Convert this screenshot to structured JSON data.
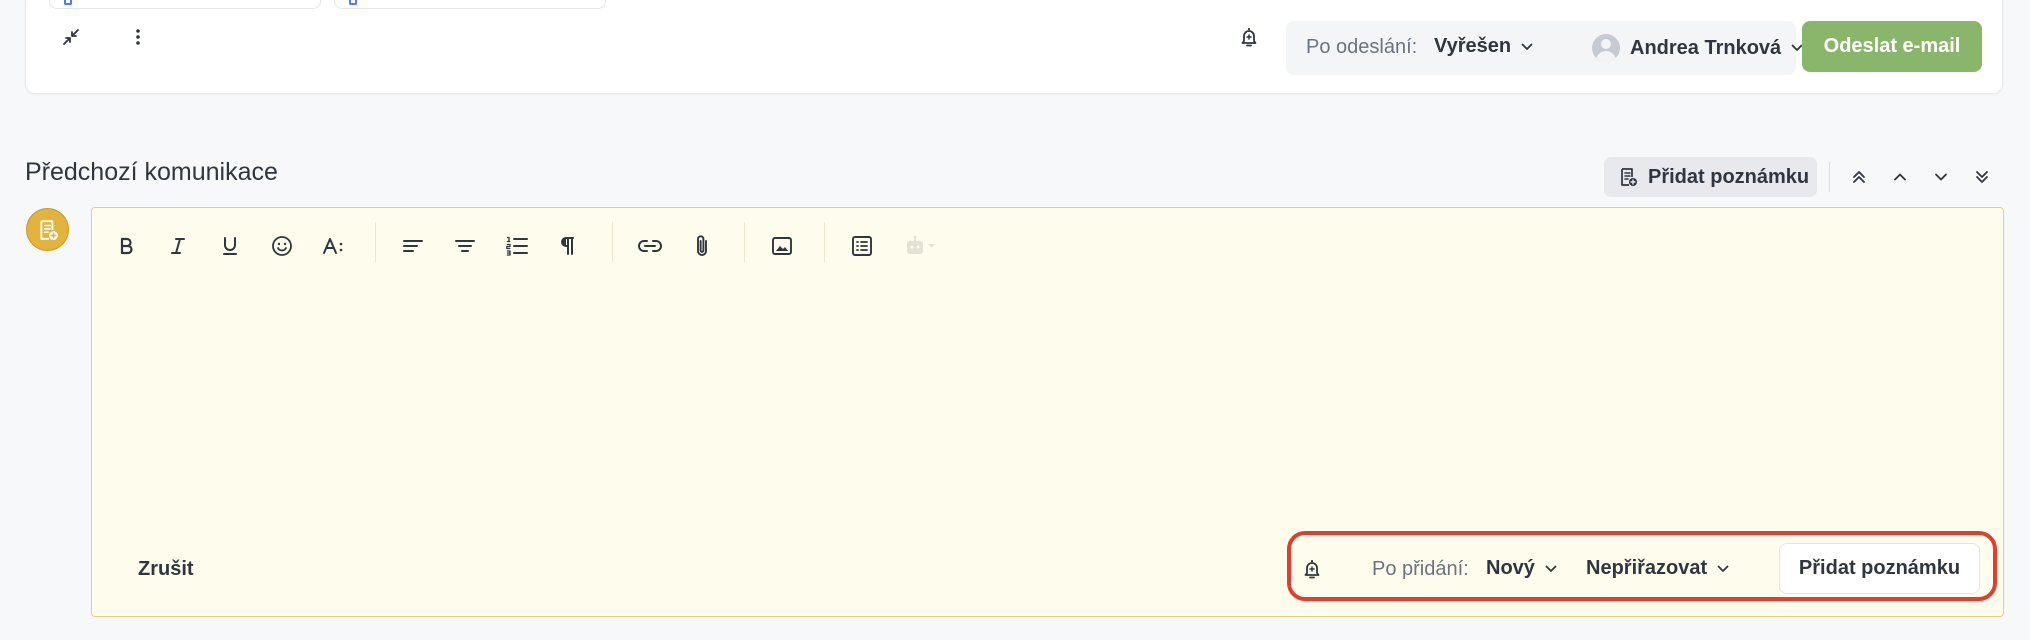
{
  "composer": {
    "after_send_label": "Po odeslání:",
    "after_send_status": "Vyřešen",
    "assignee_name": "Andrea Trnková",
    "send_label": "Odeslat e-mail"
  },
  "section": {
    "title": "Předchozí komunikace",
    "add_note_label": "Přidat poznámku"
  },
  "note_editor": {
    "toolbar": [
      "bold",
      "italic",
      "underline",
      "emoji",
      "font-size",
      "align-left",
      "align-center",
      "ordered-list",
      "paragraph",
      "link",
      "attachment",
      "image",
      "template",
      "ai-assistant"
    ],
    "cancel_label": "Zrušit",
    "after_add_label": "Po přidání:",
    "after_add_status": "Nový",
    "assign_label": "Nepřiřazovat",
    "submit_label": "Přidat poznámku"
  },
  "colors": {
    "accent_green": "#8ab66c",
    "note_background": "#fefcec",
    "note_border": "#e5cf83",
    "highlight": "#e0402b"
  }
}
